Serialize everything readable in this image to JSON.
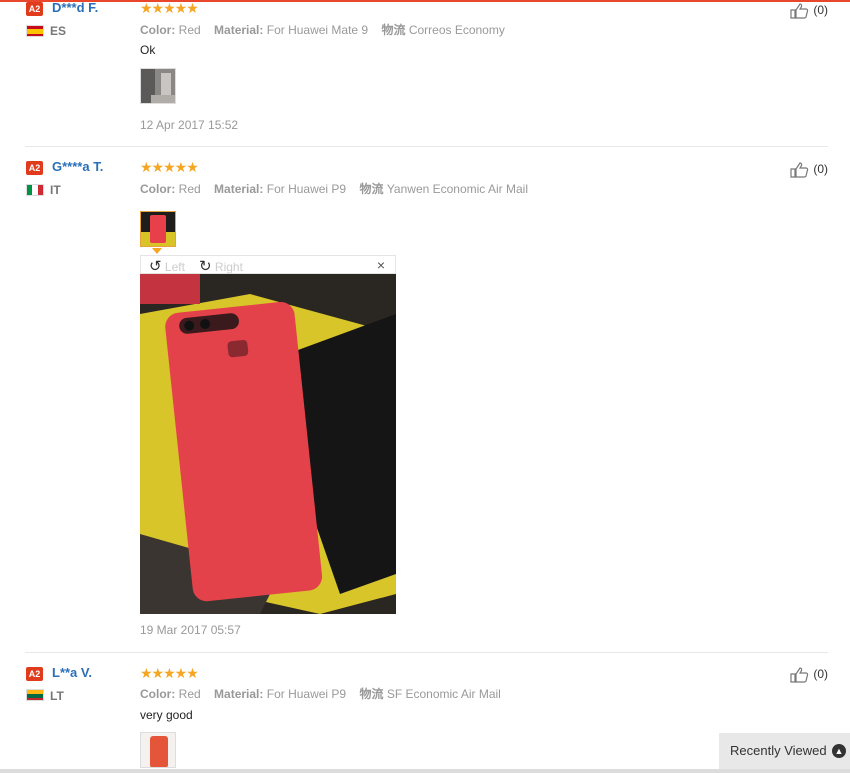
{
  "reviews": [
    {
      "badge": "A2",
      "username": "D***d F.",
      "country": "ES",
      "stars": "★★★★★",
      "color_label": "Color:",
      "color_value": "Red",
      "material_label": "Material:",
      "material_value": "For Huawei Mate 9",
      "shipping_label": "物流",
      "shipping_value": "Correos Economy",
      "feedback": "Ok",
      "date": "12 Apr 2017 15:52",
      "likes": "(0)"
    },
    {
      "badge": "A2",
      "username": "G****a T.",
      "country": "IT",
      "stars": "★★★★★",
      "color_label": "Color:",
      "color_value": "Red",
      "material_label": "Material:",
      "material_value": "For Huawei P9",
      "shipping_label": "物流",
      "shipping_value": "Yanwen Economic Air Mail",
      "date": "19 Mar 2017 05:57",
      "likes": "(0)"
    },
    {
      "badge": "A2",
      "username": "L**a V.",
      "country": "LT",
      "stars": "★★★★★",
      "color_label": "Color:",
      "color_value": "Red",
      "material_label": "Material:",
      "material_value": "For Huawei P9",
      "shipping_label": "物流",
      "shipping_value": "SF Economic Air Mail",
      "feedback": "very good",
      "likes": "(0)"
    }
  ],
  "viewer": {
    "rotate_left": "Left",
    "rotate_right": "Right",
    "close": "×"
  },
  "recently_viewed": "Recently Viewed",
  "colors": {
    "accent": "#e8472b",
    "username": "#2a6fb8",
    "stars": "#f5a623"
  }
}
